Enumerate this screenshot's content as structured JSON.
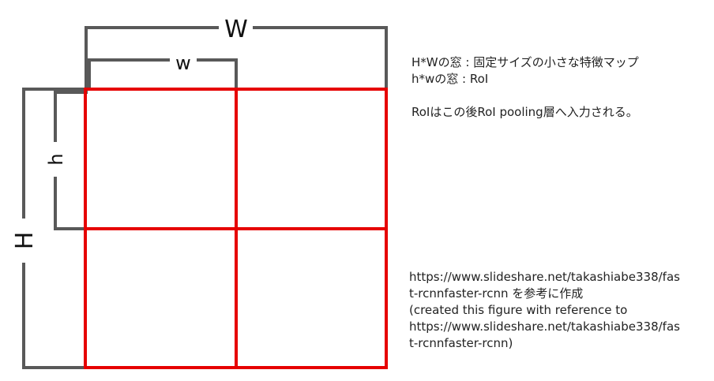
{
  "labels": {
    "big_width": "W",
    "small_width": "w",
    "small_height": "h",
    "big_height": "H"
  },
  "notes": [
    "H*Wの窓 : 固定サイズの小さな特徴マップ",
    "h*wの窓 : RoI",
    "RoIはこの後RoI pooling層へ入力される。"
  ],
  "reference": [
    "https://www.slideshare.net/takashiabe338/fas",
    "t-rcnnfaster-rcnn を参考に作成",
    "(created this figure with reference to",
    "https://www.slideshare.net/takashiabe338/fas",
    "t-rcnnfaster-rcnn)"
  ],
  "colors": {
    "grid": "#e60000",
    "bracket": "#595959",
    "text": "#222222"
  }
}
